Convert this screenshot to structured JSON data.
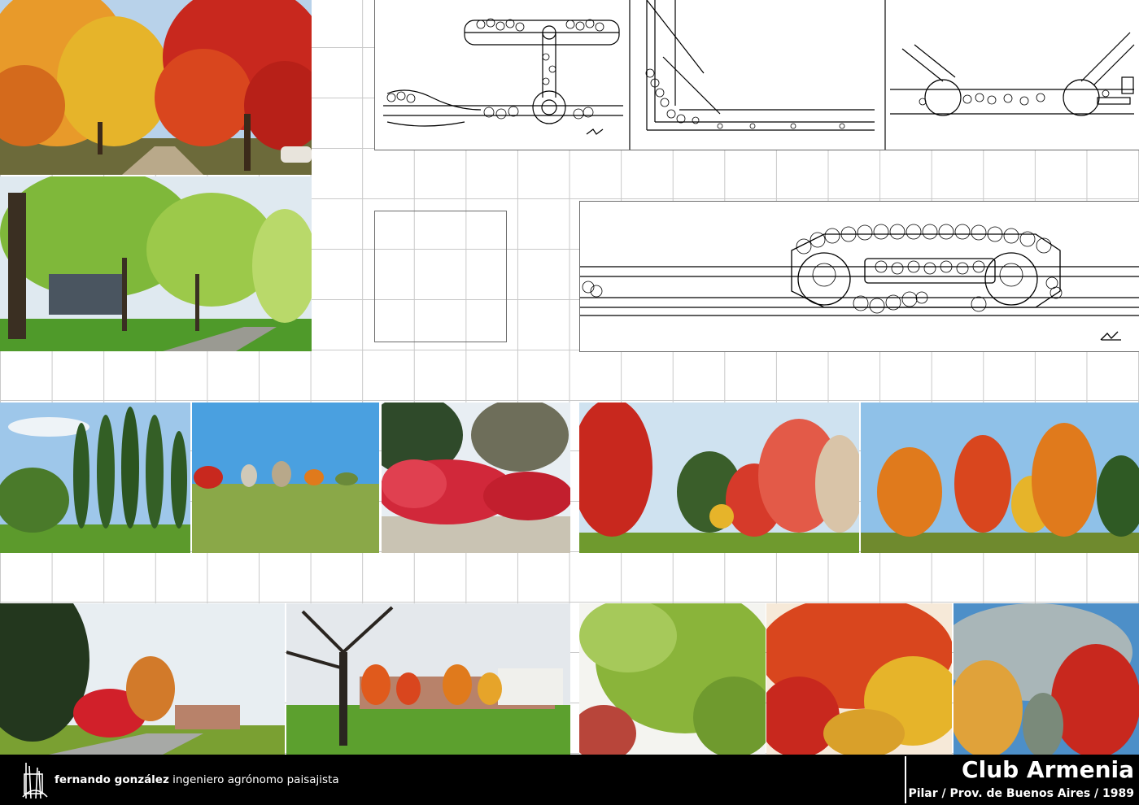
{
  "footer": {
    "firm_name": "fernando gonzález",
    "firm_role": "ingeniero agrónomo paisajista",
    "project_title": "Club Armenia",
    "project_subtitle": "Pilar / Prov. de Buenos Aires / 1989"
  },
  "colors": {
    "background": "#ffffff",
    "grid_line": "#c9c9c9",
    "footer_bg": "#000000",
    "footer_text": "#ffffff",
    "autumn_red": "#c8281e",
    "autumn_orange": "#e07a1c",
    "autumn_yellow": "#e6b42a",
    "lawn_green": "#6f9a2e",
    "sky_blue": "#8fc1e8"
  },
  "icons": [
    "firm-logo-icon"
  ]
}
